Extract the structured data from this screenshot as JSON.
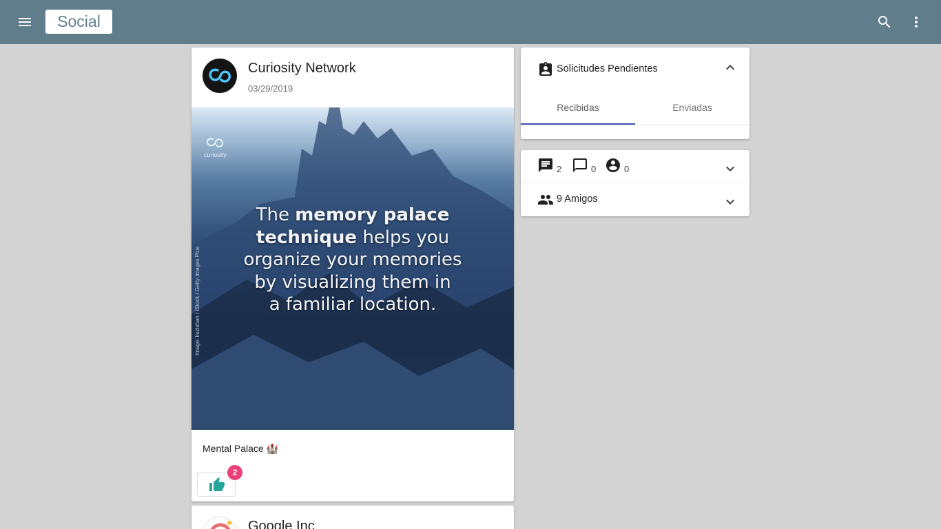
{
  "app": {
    "title": "Social"
  },
  "colors": {
    "appbar": "#607d8b",
    "accent": "#3f51b5",
    "like": "#26a69a",
    "badge": "#ec407a"
  },
  "header": {
    "menu_icon": "menu-icon",
    "search_icon": "search-icon",
    "more_icon": "more-vert-icon"
  },
  "post": {
    "author": "Curiosity Network",
    "date": "03/29/2019",
    "image": {
      "brand": "curiosity",
      "caption_parts": [
        "The",
        "memory palace",
        "technique",
        "helps you",
        "organize your memories",
        "by visualizing them in",
        "a familiar location."
      ],
      "credit": "Image: liuzishan / iStock / Getty Images Plus"
    },
    "text": "Mental Palace 🏰",
    "likes": "2",
    "like_icon": "thumb-up-icon"
  },
  "next_post": {
    "author": "Google Inc"
  },
  "requests": {
    "title": "Solicitudes Pendientes",
    "icon": "assignment-ind-icon",
    "tabs": [
      {
        "label": "Recibidas",
        "active": true
      },
      {
        "label": "Enviadas",
        "active": false
      }
    ]
  },
  "stats": {
    "items": [
      {
        "icon": "chat-icon",
        "count": "2"
      },
      {
        "icon": "chat-bubble-outline-icon",
        "count": "0"
      },
      {
        "icon": "account-circle-icon",
        "count": "0"
      }
    ],
    "friends_label": "9 Amigos",
    "friends_icon": "people-icon"
  }
}
